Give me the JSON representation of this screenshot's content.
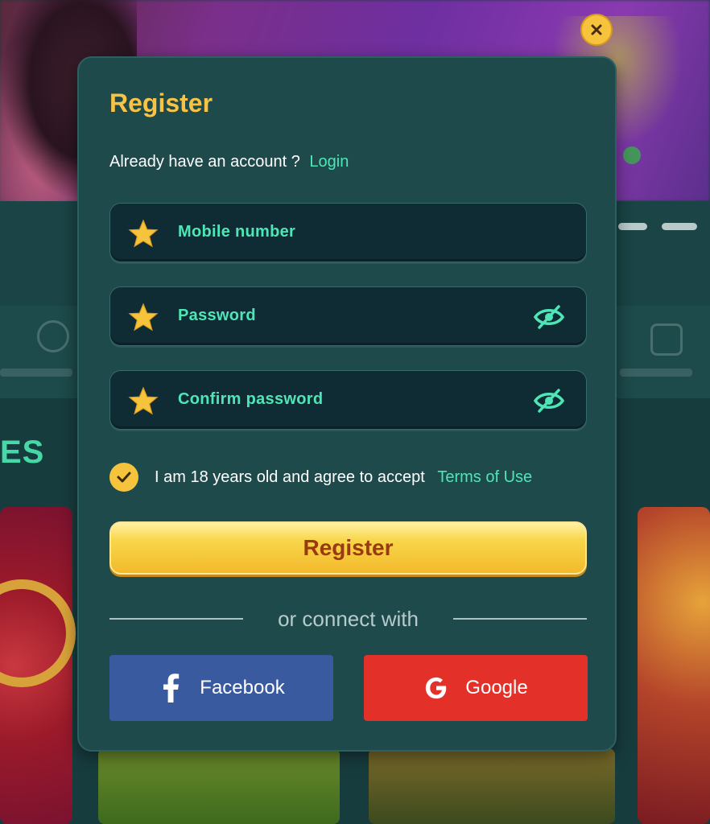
{
  "modal": {
    "title": "Register",
    "login_prompt": "Already have an account ?",
    "login_link": "Login",
    "fields": [
      {
        "label": "Mobile number",
        "icon": "star-icon",
        "has_eye": false
      },
      {
        "label": "Password",
        "icon": "star-icon",
        "has_eye": true
      },
      {
        "label": "Confirm password",
        "icon": "star-icon",
        "has_eye": true
      }
    ],
    "agree_text": "I am 18 years old and agree to accept",
    "terms_link": "Terms of Use",
    "agree_checked": true,
    "register_label": "Register",
    "divider_text": "or connect with",
    "facebook_label": "Facebook",
    "google_label": "Google"
  },
  "background": {
    "section_title": "ES"
  },
  "colors": {
    "accent_yellow": "#f6c346",
    "accent_mint": "#4ee6b6",
    "modal_bg": "#1e4a4c",
    "field_bg": "#0f2c34",
    "facebook": "#3a5aa0",
    "google": "#e3312a"
  }
}
